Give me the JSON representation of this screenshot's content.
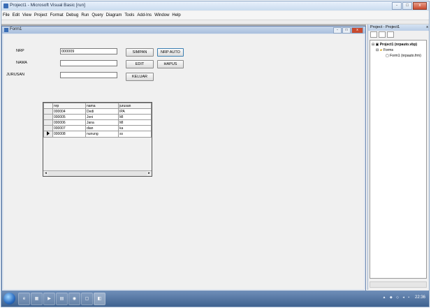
{
  "app": {
    "title": "Project1 - Microsoft Visual Basic [run]"
  },
  "menu": [
    "File",
    "Edit",
    "View",
    "Project",
    "Format",
    "Debug",
    "Run",
    "Query",
    "Diagram",
    "Tools",
    "Add-Ins",
    "Window",
    "Help"
  ],
  "form": {
    "title": "Form1",
    "labels": {
      "nrp": "NRP",
      "nama": "NAMA",
      "jurusan": "JURUSAN"
    },
    "inputs": {
      "nrp": "000009",
      "nama": "",
      "jurusan": ""
    },
    "buttons": {
      "simpan": "SIMPAN",
      "nrp_auto": "NRP AUTO",
      "edit": "EDIT",
      "hapus": "HAPUS",
      "keluar": "KELUAR"
    }
  },
  "grid": {
    "columns": [
      "nrp",
      "nama",
      "jurusan"
    ],
    "rows": [
      [
        "000004",
        "Dedi",
        "IPA"
      ],
      [
        "000005",
        "Joni",
        "MI"
      ],
      [
        "000006",
        "Jana",
        "MI"
      ],
      [
        "000007",
        "dian",
        "ka"
      ],
      [
        "000008",
        "nunung",
        "ss"
      ]
    ]
  },
  "project_explorer": {
    "title": "Project - Project1",
    "close": "x",
    "project": "Project1 (nrpauto.vbp)",
    "folder": "Forms",
    "form_item": "Form1 (nrpauto.frm)"
  },
  "window_controls": {
    "min": "-",
    "max": "□",
    "close": "x"
  },
  "taskbar": {
    "clock": "22:36"
  }
}
